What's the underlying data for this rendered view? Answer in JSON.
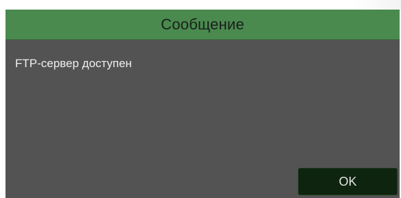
{
  "dialog": {
    "title": "Сообщение",
    "message": "FTP-сервер доступен",
    "ok_label": "OK"
  },
  "colors": {
    "header_green": "#4a8a4e",
    "body_gray": "#535353",
    "button_dark_green": "#0e240e",
    "text_light": "#f0f0f0"
  }
}
